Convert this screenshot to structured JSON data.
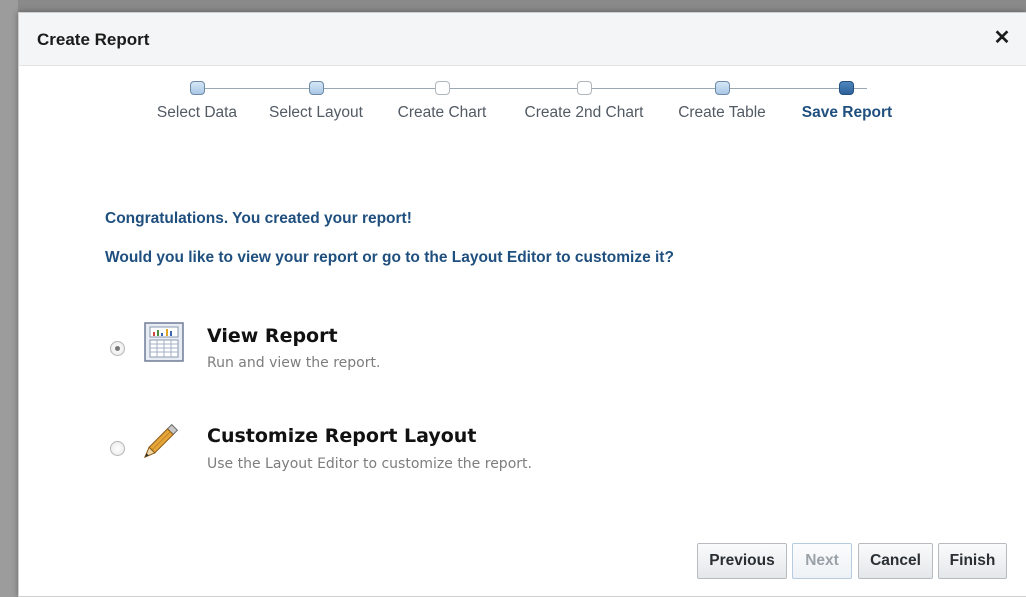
{
  "dialog": {
    "title": "Create Report",
    "close_icon": "close-icon"
  },
  "train": {
    "steps": [
      {
        "label": "Select Data",
        "state": "visited"
      },
      {
        "label": "Select Layout",
        "state": "visited"
      },
      {
        "label": "Create Chart",
        "state": "unvisited"
      },
      {
        "label": "Create 2nd Chart",
        "state": "unvisited"
      },
      {
        "label": "Create Table",
        "state": "visited"
      },
      {
        "label": "Save Report",
        "state": "current"
      }
    ]
  },
  "content": {
    "congrats": "Congratulations. You created your report!",
    "question": "Would you like to view your report or go to the Layout Editor to customize it?"
  },
  "options": {
    "view": {
      "title": "View Report",
      "description": "Run and view the report.",
      "selected": true,
      "icon": "report-table-icon"
    },
    "customize": {
      "title": "Customize Report Layout",
      "description": "Use the Layout Editor to customize the report.",
      "selected": false,
      "icon": "pencil-icon"
    }
  },
  "buttons": {
    "previous": "Previous",
    "next": "Next",
    "cancel": "Cancel",
    "finish": "Finish"
  },
  "colors": {
    "accent_text": "#1f4f7e",
    "current_step": "#2d6299"
  }
}
